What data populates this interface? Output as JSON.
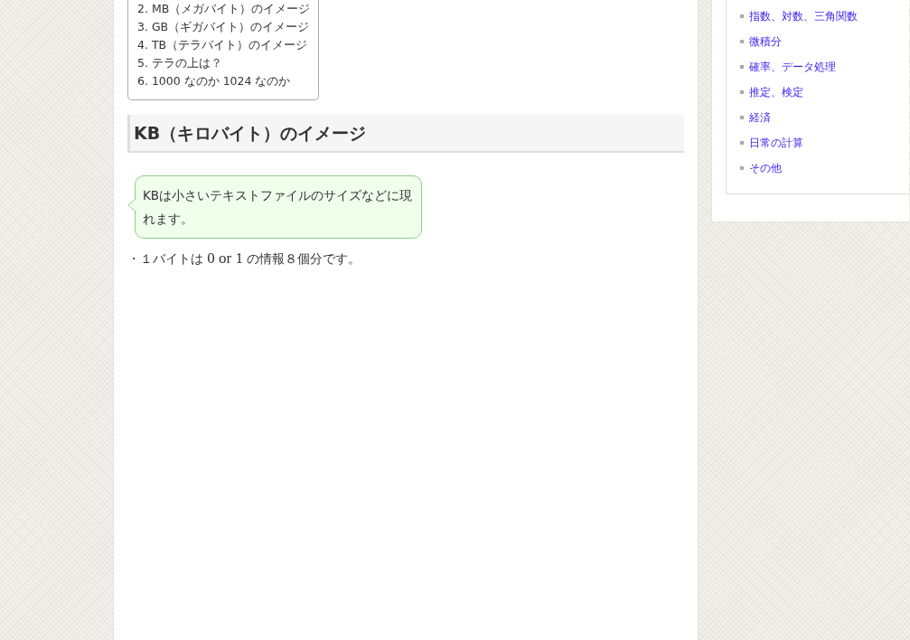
{
  "toc": {
    "items": [
      "2. MB（メガバイト）のイメージ",
      "3. GB（ギガバイト）のイメージ",
      "4. TB（テラバイト）のイメージ",
      "5. テラの上は？",
      "6. 1000 なのか 1024 なのか"
    ]
  },
  "heading": "KB（キロバイト）のイメージ",
  "speech_bubble": "KBは小さいテキストファイルのサイズなどに現れます。",
  "bullet": [
    {
      "kind": "plain",
      "text": "・１バイトは "
    },
    {
      "kind": "math",
      "text": "0 or 1"
    },
    {
      "kind": "plain",
      "text": " の情報８個分です。"
    }
  ],
  "sidebar": {
    "links": [
      "指数、対数、三角関数",
      "微積分",
      "確率、データ処理",
      "推定、検定",
      "経済",
      "日常の計算",
      "その他"
    ]
  }
}
